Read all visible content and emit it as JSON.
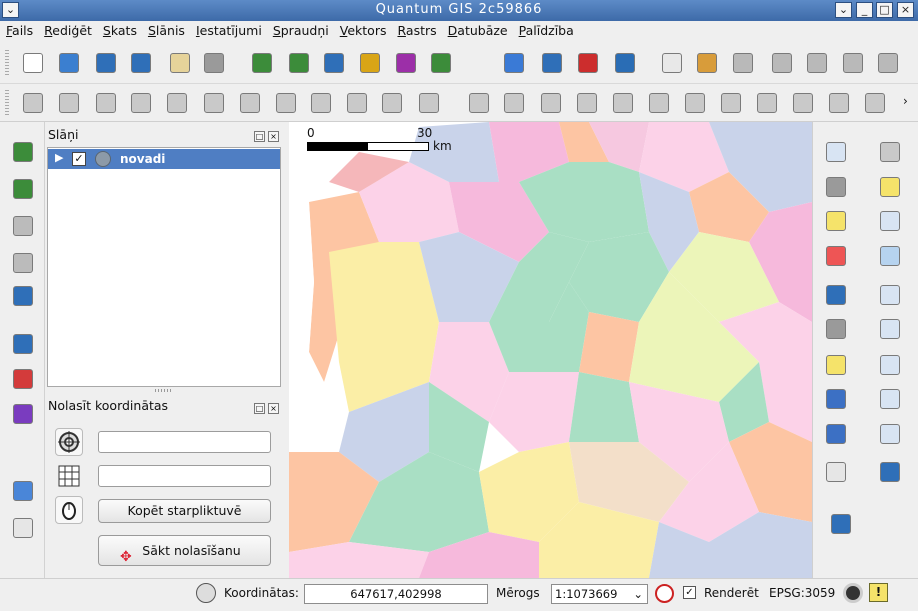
{
  "window": {
    "title": "Quantum GIS 2c59866"
  },
  "menu": [
    "Fails",
    "Rediģēt",
    "Skats",
    "Slānis",
    "Iestatījumi",
    "Spraudņi",
    "Vektors",
    "Rastrs",
    "Datubāze",
    "Palīdzība"
  ],
  "toolbar1": {
    "icons": [
      "new-project-icon",
      "open-project-icon",
      "save-project-icon",
      "save-as-icon",
      "print-composer-icon",
      "print-icon",
      "add-vector-layer-icon",
      "add-raster-layer-icon",
      "add-postgis-layer-icon",
      "add-spatialite-layer-icon",
      "add-mssql-layer-icon",
      "add-wms-layer-icon",
      "add-wfs-layer-icon",
      "new-shapefile-icon",
      "remove-layer-icon",
      "gps-icon",
      "label-icon",
      "layer-properties-icon",
      "measure-icon",
      "show-hide-icon",
      "style-icon",
      "tag-icon",
      "plugin-icon"
    ],
    "colors": [
      "#ffffff",
      "#3b7fd0",
      "#2f6fb8",
      "#2f6fb8",
      "#e6d39a",
      "#9a9a9a",
      "#3c8c3a",
      "#3c8c3a",
      "#2f6fb8",
      "#d9a516",
      "#9c2fa8",
      "#3c8c3a",
      "#3a7ad6",
      "#2f6fb8",
      "#cc2d2d",
      "#2a6db5",
      "#e8e8e8",
      "#d89c3a",
      "#b9b9b9",
      "#b9b9b9",
      "#b9b9b9",
      "#b9b9b9",
      "#b9b9b9"
    ]
  },
  "toolbar2": {
    "icons": [
      "save-edits-icon",
      "digitize-icon",
      "save-layer-edits-icon",
      "add-feature-icon",
      "move-feature-icon",
      "node-tool-icon",
      "delete-selected-icon",
      "cut-features-icon",
      "copy-features-icon",
      "paste-features-icon",
      "simplify-icon",
      "split-icon",
      "undo-icon",
      "redo-icon",
      "add-ring-icon",
      "add-part-icon",
      "fill-ring-icon",
      "delete-ring-icon",
      "delete-part-icon",
      "reshape-icon",
      "offset-curve-icon",
      "split-parts-icon",
      "merge-features-icon",
      "merge-attributes-icon",
      "rotate-point-icon",
      "node-tool-2-icon"
    ]
  },
  "lefttools": [
    "add-vector-icon",
    "add-raster-icon",
    "add-postgis-icon",
    "add-spatialite-icon",
    "add-wms-icon",
    "measure-tool-icon",
    "new-layer-icon",
    "grid-icon",
    "help-book-icon",
    "whats-this-icon"
  ],
  "layers_panel": {
    "title": "Slāņi",
    "layer": {
      "name": "novadi",
      "checked": true
    }
  },
  "coord_panel": {
    "title": "Nolasīt koordinātas",
    "field1": "",
    "field2": "",
    "copy_button": "Kopēt starpliktuvē",
    "start_button": "Sākt nolasīšanu"
  },
  "map": {
    "scale_bar": {
      "start": "0",
      "end": "30",
      "unit": "km"
    }
  },
  "righttools": [
    "identify-icon",
    "pan-icon",
    "action-gear-icon",
    "pan-to-selection-icon",
    "select-feature-icon",
    "zoom-in-icon",
    "deselect-icon",
    "zoom-out-icon",
    "attribute-table-icon",
    "zoom-full-icon",
    "measure-line-icon",
    "zoom-to-layer-icon",
    "annotation-icon",
    "zoom-to-selection-icon",
    "map-tips-icon",
    "zoom-last-icon",
    "home-icon",
    "zoom-next-icon",
    "text-annotation-icon",
    "refresh-icon",
    "database-icon"
  ],
  "statusbar": {
    "coord_label": "Koordinātas:",
    "coord_value": "647617,402998",
    "scale_label": "Mērogs",
    "scale_value": "1:1073669",
    "render_label": "Renderēt",
    "render_checked": true,
    "crs": "EPSG:3059"
  }
}
